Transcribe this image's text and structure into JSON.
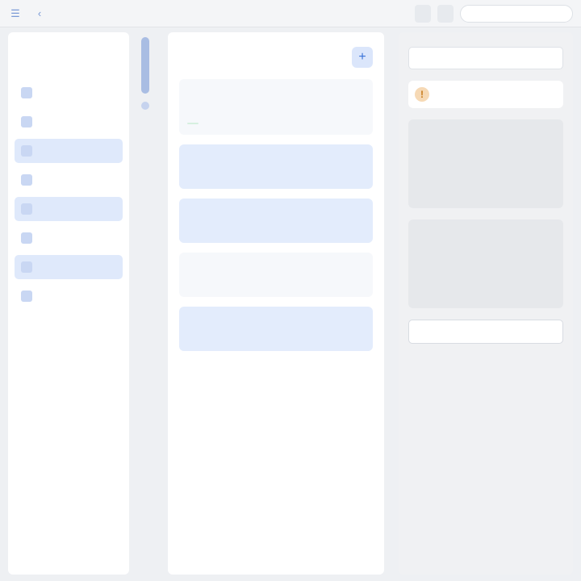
{
  "topbar": {
    "title": "",
    "buttons": [
      "",
      ""
    ],
    "search_placeholder": ""
  },
  "left": {
    "brand": "",
    "section_title": "",
    "items": [
      {
        "label": "",
        "active": false
      },
      {
        "label": "",
        "active": false
      },
      {
        "label": "",
        "active": true
      },
      {
        "label": "",
        "active": false
      },
      {
        "label": "",
        "active": true
      },
      {
        "label": "",
        "active": false
      },
      {
        "label": "",
        "active": true
      },
      {
        "label": "",
        "active": false
      }
    ]
  },
  "middle": {
    "title": "",
    "meta": "",
    "cards": [
      {
        "title": "",
        "subtitle": "",
        "tag": ""
      },
      {
        "title": "",
        "subtitle": ""
      },
      {
        "title": "",
        "subtitle": ""
      },
      {
        "title": "",
        "subtitle": ""
      },
      {
        "title": "",
        "subtitle": ""
      }
    ]
  },
  "right": {
    "field_label": "",
    "field_value": "",
    "notice": "",
    "block_text": "",
    "save_label": ""
  },
  "colors": {
    "accent": "#2f6ad6",
    "accent_light": "#dfe9fb",
    "warning": "#f6d9b5",
    "success_tag": "#d6f0e0"
  }
}
